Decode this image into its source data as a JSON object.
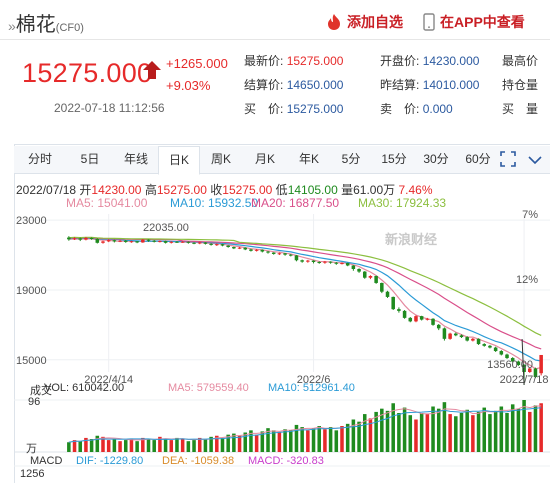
{
  "header": {
    "title": "棉花",
    "symbol": "(CF0)",
    "title_mark": "»",
    "add_label": "添加自选",
    "app_label": "在APP中查看"
  },
  "quote": {
    "price": "15275.000",
    "change": "+1265.000",
    "change_pct": "+9.03%",
    "time": "2022-07-18 11:12:56",
    "fields": [
      {
        "label": "最新价:",
        "value": "15275.000",
        "dir": "up"
      },
      {
        "label": "开盘价:",
        "value": "14230.000",
        "dir": ""
      },
      {
        "label": "最高价",
        "value": "",
        "dir": ""
      },
      {
        "label": "结算价:",
        "value": "14650.000",
        "dir": ""
      },
      {
        "label": "昨结算:",
        "value": "14010.000",
        "dir": ""
      },
      {
        "label": "持仓量",
        "value": "",
        "dir": ""
      },
      {
        "label": "买　价:",
        "value": "15275.000",
        "dir": ""
      },
      {
        "label": "卖　价:",
        "value": "0.000",
        "dir": ""
      },
      {
        "label": "买　量",
        "value": "",
        "dir": ""
      }
    ]
  },
  "tabs": [
    "分时",
    "5日",
    "年线",
    "日K",
    "周K",
    "月K",
    "年K",
    "5分",
    "15分",
    "30分",
    "60分"
  ],
  "active_tab": "日K",
  "info": {
    "date": "2022/07/18",
    "open_label": "开",
    "open": "14230.00",
    "high_label": "高",
    "high": "15275.00",
    "close_label": "收",
    "close": "15275.00",
    "low_label": "低",
    "low": "14105.00",
    "vol_label": "量",
    "vol": "61.00万",
    "pct": "7.46%"
  },
  "ma": [
    {
      "label": "MA5: 15041.00",
      "color": "#e58aa0"
    },
    {
      "label": "MA10: 15932.50",
      "color": "#2b9bd6"
    },
    {
      "label": "MA20: 16877.50",
      "color": "#d94f8a"
    },
    {
      "label": "MA30: 17924.33",
      "color": "#8cbf3f"
    }
  ],
  "watermark": "新浪财经",
  "chart_data": {
    "type": "candlestick",
    "y_ticks": [
      "23000",
      "19000",
      "15000"
    ],
    "right_ticks": [
      "7%",
      "12%"
    ],
    "x_labels": [
      "2022/4/14",
      "2022/6",
      "2022/7/18"
    ],
    "annotations": {
      "high": "22035.00",
      "low": "13560.00"
    },
    "ylim": [
      14300,
      23350
    ],
    "candles": [
      [
        22000,
        21900,
        22080,
        21820
      ],
      [
        21900,
        21950,
        22020,
        21860
      ],
      [
        21950,
        21880,
        22000,
        21800
      ],
      [
        21880,
        21980,
        22035,
        21840
      ],
      [
        21980,
        21920,
        22010,
        21870
      ],
      [
        21920,
        21700,
        21960,
        21660
      ],
      [
        21700,
        21780,
        21820,
        21650
      ],
      [
        21780,
        21850,
        21900,
        21740
      ],
      [
        21850,
        21780,
        21880,
        21720
      ],
      [
        21780,
        21820,
        21870,
        21740
      ],
      [
        21820,
        21750,
        21860,
        21700
      ],
      [
        21750,
        21790,
        21820,
        21700
      ],
      [
        21790,
        21720,
        21800,
        21680
      ],
      [
        21720,
        21880,
        21920,
        21700
      ],
      [
        21880,
        21820,
        21900,
        21760
      ],
      [
        21820,
        21760,
        21860,
        21720
      ],
      [
        21760,
        21800,
        21840,
        21720
      ],
      [
        21800,
        21700,
        21820,
        21660
      ],
      [
        21700,
        21760,
        21790,
        21660
      ],
      [
        21760,
        21730,
        21800,
        21690
      ],
      [
        21730,
        21760,
        21800,
        21700
      ],
      [
        21760,
        21700,
        21780,
        21650
      ],
      [
        21700,
        21660,
        21730,
        21620
      ],
      [
        21660,
        21720,
        21760,
        21620
      ],
      [
        21720,
        21640,
        21740,
        21600
      ],
      [
        21640,
        21580,
        21680,
        21540
      ],
      [
        21580,
        21620,
        21660,
        21520
      ],
      [
        21620,
        21540,
        21640,
        21500
      ],
      [
        21540,
        21460,
        21560,
        21420
      ],
      [
        21460,
        21380,
        21480,
        21340
      ],
      [
        21380,
        21420,
        21460,
        21340
      ],
      [
        21420,
        21320,
        21440,
        21280
      ],
      [
        21320,
        21240,
        21360,
        21200
      ],
      [
        21240,
        21300,
        21340,
        21200
      ],
      [
        21300,
        21200,
        21320,
        21150
      ],
      [
        21200,
        21140,
        21230,
        21080
      ],
      [
        21140,
        21060,
        21160,
        21020
      ],
      [
        21060,
        21100,
        21140,
        21000
      ],
      [
        21100,
        21020,
        21120,
        20960
      ],
      [
        21020,
        20980,
        21060,
        20920
      ],
      [
        20980,
        20700,
        21000,
        20640
      ],
      [
        20700,
        20620,
        20740,
        20560
      ],
      [
        20620,
        20680,
        20720,
        20560
      ],
      [
        20680,
        20600,
        20700,
        20520
      ],
      [
        20600,
        20560,
        20640,
        20500
      ],
      [
        20560,
        20620,
        20660,
        20500
      ],
      [
        20620,
        20560,
        20640,
        20500
      ],
      [
        20560,
        20500,
        20600,
        20440
      ],
      [
        20500,
        20540,
        20580,
        20460
      ],
      [
        20540,
        20400,
        20560,
        20360
      ],
      [
        20400,
        20200,
        20420,
        20100
      ],
      [
        20200,
        20050,
        20240,
        19980
      ],
      [
        20050,
        19700,
        20080,
        19640
      ],
      [
        19700,
        19800,
        19840,
        19620
      ],
      [
        19800,
        19400,
        19820,
        19350
      ],
      [
        19400,
        18900,
        19420,
        18820
      ],
      [
        18900,
        18600,
        18950,
        18540
      ],
      [
        18600,
        17900,
        18620,
        17850
      ],
      [
        17900,
        17800,
        18000,
        17700
      ],
      [
        17800,
        17400,
        17850,
        17350
      ],
      [
        17400,
        17200,
        17450,
        17150
      ],
      [
        17200,
        17500,
        17540,
        17150
      ],
      [
        17500,
        17300,
        17520,
        17250
      ],
      [
        17300,
        17350,
        17400,
        17250
      ],
      [
        17350,
        17000,
        17380,
        16950
      ],
      [
        17000,
        16800,
        17050,
        16700
      ],
      [
        16800,
        16200,
        16850,
        16100
      ],
      [
        16200,
        16500,
        16550,
        16150
      ],
      [
        16500,
        16400,
        16560,
        16350
      ],
      [
        16400,
        16300,
        16450,
        16250
      ],
      [
        16300,
        16100,
        16350,
        16050
      ],
      [
        16100,
        16200,
        16250,
        16050
      ],
      [
        16200,
        15900,
        16230,
        15850
      ],
      [
        15900,
        15800,
        15950,
        15750
      ],
      [
        15800,
        15700,
        15850,
        15650
      ],
      [
        15700,
        15500,
        15750,
        15450
      ],
      [
        15500,
        15300,
        15550,
        15250
      ],
      [
        15300,
        15100,
        15350,
        15050
      ],
      [
        15100,
        14900,
        15150,
        14850
      ],
      [
        14900,
        14700,
        14950,
        14650
      ],
      [
        14700,
        14300,
        14750,
        13560
      ],
      [
        14300,
        14500,
        14560,
        14250
      ],
      [
        14500,
        14010,
        14550,
        13950
      ],
      [
        14230,
        15275,
        15275,
        14105
      ]
    ],
    "volume_label": "成交",
    "volume_values": "VOL: 610042.00",
    "volume_ma5": "MA5: 579559.40",
    "volume_ma10": "MA10: 512961.40",
    "volume_tick": "96",
    "volume_unit": "万",
    "volumes": [
      18,
      22,
      20,
      26,
      24,
      30,
      28,
      22,
      24,
      20,
      22,
      25,
      20,
      26,
      24,
      22,
      28,
      24,
      22,
      26,
      24,
      20,
      22,
      26,
      24,
      28,
      30,
      26,
      32,
      34,
      30,
      36,
      40,
      32,
      38,
      44,
      40,
      36,
      42,
      40,
      50,
      46,
      40,
      44,
      48,
      42,
      46,
      40,
      48,
      52,
      60,
      56,
      70,
      62,
      74,
      80,
      76,
      90,
      72,
      82,
      68,
      60,
      72,
      70,
      84,
      80,
      92,
      70,
      66,
      72,
      78,
      68,
      74,
      82,
      70,
      76,
      84,
      72,
      88,
      80,
      96,
      74,
      86,
      90
    ],
    "macd_label": "MACD",
    "macd_tick": "1256",
    "macd_dif": "DIF: -1229.80",
    "macd_dea": "DEA: -1059.38",
    "macd_val": "MACD: -320.83"
  }
}
